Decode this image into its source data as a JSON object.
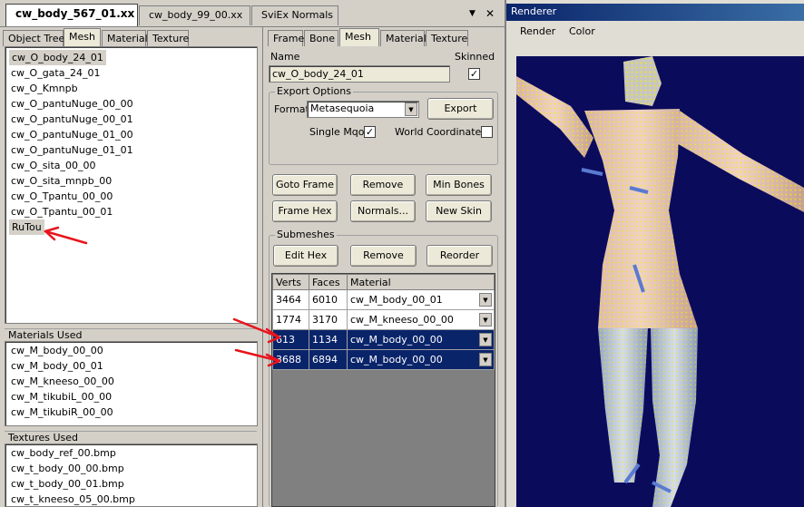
{
  "doc_tabs": [
    "cw_body_567_01.xx",
    "cw_body_99_00.xx",
    "SviEx Normals"
  ],
  "doc_controls": {
    "dropdown": "▼",
    "close": "✕"
  },
  "left_tabs": [
    "Object Tree",
    "Mesh",
    "Material",
    "Texture"
  ],
  "mesh_list": [
    "cw_O_body_24_01",
    "cw_O_gata_24_01",
    "cw_O_Kmnpb",
    "cw_O_pantuNuge_00_00",
    "cw_O_pantuNuge_00_01",
    "cw_O_pantuNuge_01_00",
    "cw_O_pantuNuge_01_01",
    "cw_O_sita_00_00",
    "cw_O_sita_mnpb_00",
    "cw_O_Tpantu_00_00",
    "cw_O_Tpantu_00_01",
    "RuTou"
  ],
  "materials_used": {
    "label": "Materials Used",
    "items": [
      "cw_M_body_00_00",
      "cw_M_body_00_01",
      "cw_M_kneeso_00_00",
      "cw_M_tikubiL_00_00",
      "cw_M_tikubiR_00_00"
    ]
  },
  "textures_used": {
    "label": "Textures Used",
    "items": [
      "cw_body_ref_00.bmp",
      "cw_t_body_00_00.bmp",
      "cw_t_body_00_01.bmp",
      "cw_t_kneeso_05_00.bmp"
    ]
  },
  "mid_tabs": [
    "Frame",
    "Bone",
    "Mesh",
    "Material",
    "Texture"
  ],
  "mesh_panel": {
    "name_label": "Name",
    "name_value": "cw_O_body_24_01",
    "skinned_label": "Skinned",
    "skinned_check": "✓",
    "export_options": {
      "label": "Export Options",
      "format_label": "Format",
      "format_value": "Metasequoia",
      "export_button": "Export",
      "single_mqo_label": "Single Mqo",
      "single_mqo_check": "✓",
      "world_coords_label": "World Coordinates"
    },
    "buttons": {
      "goto_frame": "Goto Frame",
      "remove": "Remove",
      "min_bones": "Min Bones",
      "frame_hex": "Frame Hex",
      "normals": "Normals...",
      "new_skin": "New Skin"
    },
    "submeshes": {
      "label": "Submeshes",
      "edit_hex": "Edit Hex",
      "remove": "Remove",
      "reorder": "Reorder",
      "columns": [
        "Verts",
        "Faces",
        "Material"
      ],
      "rows": [
        {
          "verts": "3464",
          "faces": "6010",
          "material": "cw_M_body_00_01"
        },
        {
          "verts": "1774",
          "faces": "3170",
          "material": "cw_M_kneeso_00_00"
        },
        {
          "verts": "613",
          "faces": "1134",
          "material": "cw_M_body_00_00"
        },
        {
          "verts": "3688",
          "faces": "6894",
          "material": "cw_M_body_00_00"
        }
      ]
    }
  },
  "renderer": {
    "title": "Renderer",
    "menu": [
      "Render",
      "Color"
    ]
  },
  "colors": {
    "annotation_arrow": "#e8141c",
    "renderer_bg": "#0b0b5c",
    "selection": "#0a246a",
    "mesh_wire": "#f0f000"
  }
}
